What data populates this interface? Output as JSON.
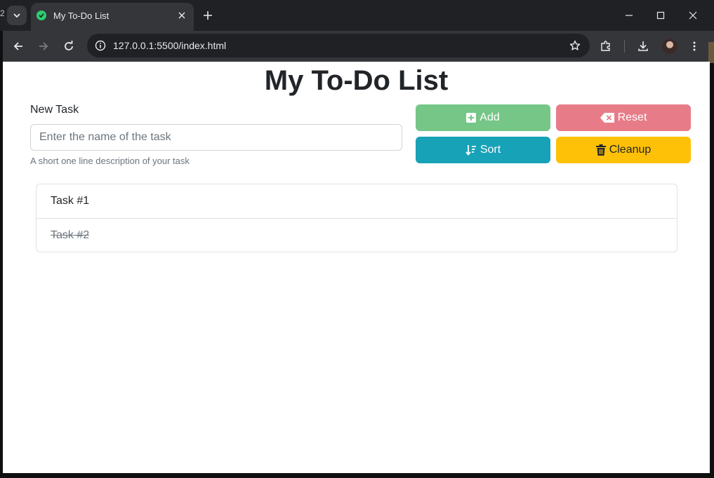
{
  "browser": {
    "tab_title": "My To-Do List",
    "url": "127.0.0.1:5500/index.html",
    "left_edge_text": "2"
  },
  "page": {
    "title": "My To-Do List",
    "new_task_label": "New Task",
    "input_placeholder": "Enter the name of the task",
    "input_value": "",
    "help_text": "A short one line description of your task"
  },
  "buttons": {
    "add": {
      "label": "Add",
      "icon": "plus-square-icon",
      "color": "#75c687"
    },
    "reset": {
      "label": "Reset",
      "icon": "backspace-icon",
      "color": "#e77c88"
    },
    "sort": {
      "label": "Sort",
      "icon": "sort-icon",
      "color": "#17a2b8"
    },
    "cleanup": {
      "label": "Cleanup",
      "icon": "trash-icon",
      "color": "#ffc107"
    }
  },
  "tasks": [
    {
      "text": "Task #1",
      "done": false
    },
    {
      "text": "Task #2",
      "done": true
    }
  ]
}
